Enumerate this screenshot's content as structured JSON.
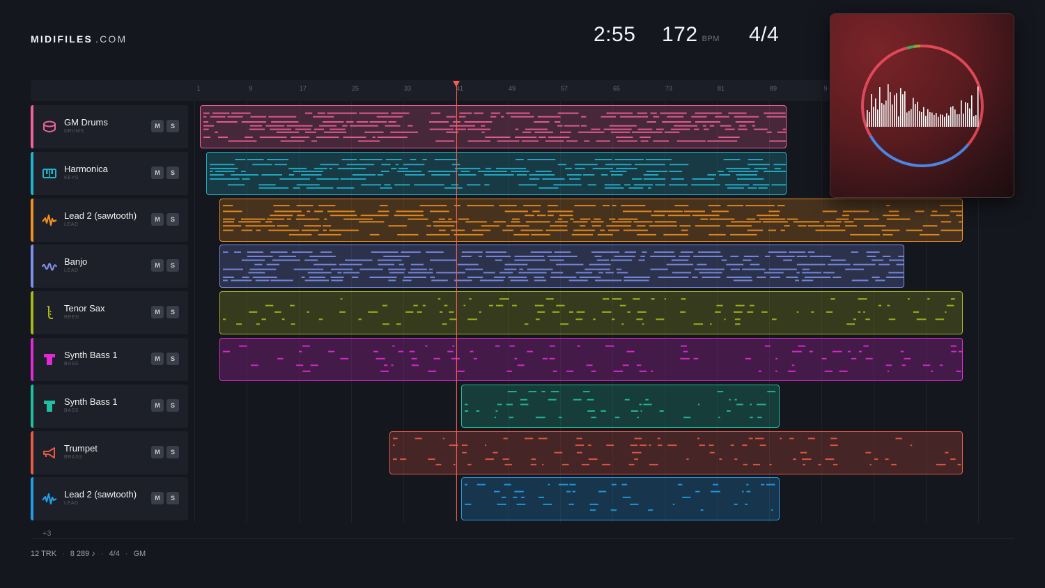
{
  "brand": {
    "name_bold": "MIDIFILES",
    "name_light": ".COM"
  },
  "transport": {
    "time": "2:55",
    "bpm": "172",
    "bpm_unit": "BPM",
    "time_signature": "4/4"
  },
  "ruler": {
    "ticks": [
      "1",
      "9",
      "17",
      "25",
      "33",
      "41",
      "49",
      "57",
      "65",
      "73",
      "81",
      "89",
      "9"
    ],
    "playhead_bar": 41
  },
  "tracks": [
    {
      "name": "GM Drums",
      "category": "DRUMS",
      "color": "#f0629a",
      "icon": "drum-icon",
      "mute": "M",
      "solo": "S",
      "clip_start_bar": 1,
      "clip_end_bar": 91
    },
    {
      "name": "Harmonica",
      "category": "KEYS",
      "color": "#22b3cc",
      "icon": "keyboard-icon",
      "mute": "M",
      "solo": "S",
      "clip_start_bar": 2,
      "clip_end_bar": 91
    },
    {
      "name": "Lead 2 (sawtooth)",
      "category": "LEAD",
      "color": "#f0901e",
      "icon": "sawtooth-wave-icon",
      "mute": "M",
      "solo": "S",
      "clip_start_bar": 4,
      "clip_end_bar": 118
    },
    {
      "name": "Banjo",
      "category": "LEAD",
      "color": "#7d8fe8",
      "icon": "wave-icon",
      "mute": "M",
      "solo": "S",
      "clip_start_bar": 4,
      "clip_end_bar": 109
    },
    {
      "name": "Tenor Sax",
      "category": "REED",
      "color": "#a6b81c",
      "icon": "saxophone-icon",
      "mute": "M",
      "solo": "S",
      "clip_start_bar": 4,
      "clip_end_bar": 118
    },
    {
      "name": "Synth Bass 1",
      "category": "BASS",
      "color": "#e229d6",
      "icon": "bass-icon",
      "mute": "M",
      "solo": "S",
      "clip_start_bar": 4,
      "clip_end_bar": 118
    },
    {
      "name": "Synth Bass 1",
      "category": "BASS",
      "color": "#1fc0a0",
      "icon": "bass-icon",
      "mute": "M",
      "solo": "S",
      "clip_start_bar": 41,
      "clip_end_bar": 90
    },
    {
      "name": "Trumpet",
      "category": "BRASS",
      "color": "#e95a43",
      "icon": "trumpet-icon",
      "mute": "M",
      "solo": "S",
      "clip_start_bar": 30,
      "clip_end_bar": 118
    },
    {
      "name": "Lead 2 (sawtooth)",
      "category": "LEAD",
      "color": "#1f9ee8",
      "icon": "sawtooth-wave-icon",
      "mute": "M",
      "solo": "S",
      "clip_start_bar": 41,
      "clip_end_bar": 90
    }
  ],
  "more_tracks": "+3",
  "footer": {
    "tracks": "12 TRK",
    "notes": "8 289 ♪",
    "signature": "4/4",
    "standard": "GM",
    "separator": "·"
  }
}
